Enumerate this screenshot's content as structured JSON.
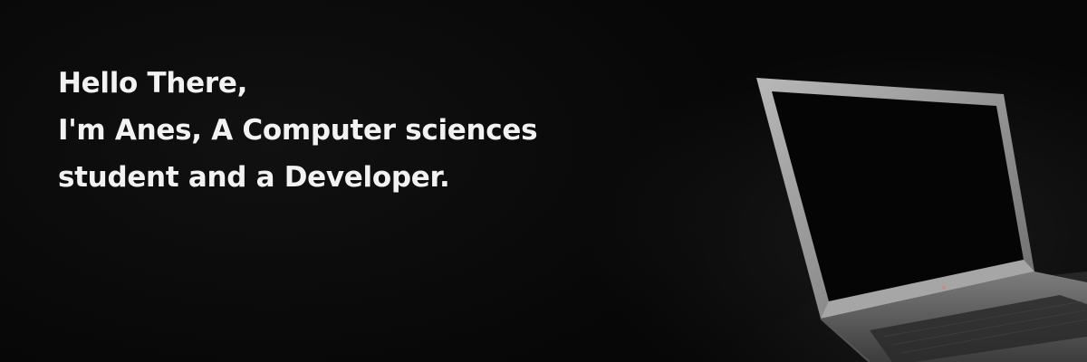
{
  "hero": {
    "greeting": "Hello There,",
    "intro_line_1": "I'm Anes, A Computer sciences",
    "intro_line_2": "student and a Developer."
  },
  "background": {
    "image": "laptop-photo",
    "colors": {
      "base": "#070707",
      "text": "#f2f2f2",
      "laptop_frame": "#9a9a9a",
      "laptop_screen": "#050505"
    }
  }
}
